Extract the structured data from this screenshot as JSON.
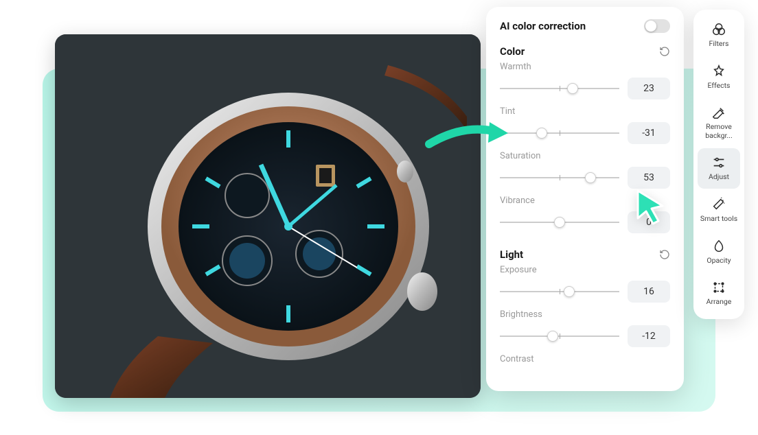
{
  "panel": {
    "ai_label": "AI color correction",
    "sections": {
      "color": {
        "title": "Color",
        "warmth": {
          "label": "Warmth",
          "value": "23",
          "pos": 61
        },
        "tint": {
          "label": "Tint",
          "value": "-31",
          "pos": 35
        },
        "saturation": {
          "label": "Saturation",
          "value": "53",
          "pos": 76
        },
        "vibrance": {
          "label": "Vibrance",
          "value": "0",
          "pos": 50
        }
      },
      "light": {
        "title": "Light",
        "exposure": {
          "label": "Exposure",
          "value": "16",
          "pos": 58
        },
        "brightness": {
          "label": "Brightness",
          "value": "-12",
          "pos": 44
        },
        "contrast": {
          "label": "Contrast"
        }
      }
    }
  },
  "tools": {
    "filters": "Filters",
    "effects": "Effects",
    "remove_bg": "Remove backgr...",
    "adjust": "Adjust",
    "smart": "Smart tools",
    "opacity": "Opacity",
    "arrange": "Arrange"
  }
}
